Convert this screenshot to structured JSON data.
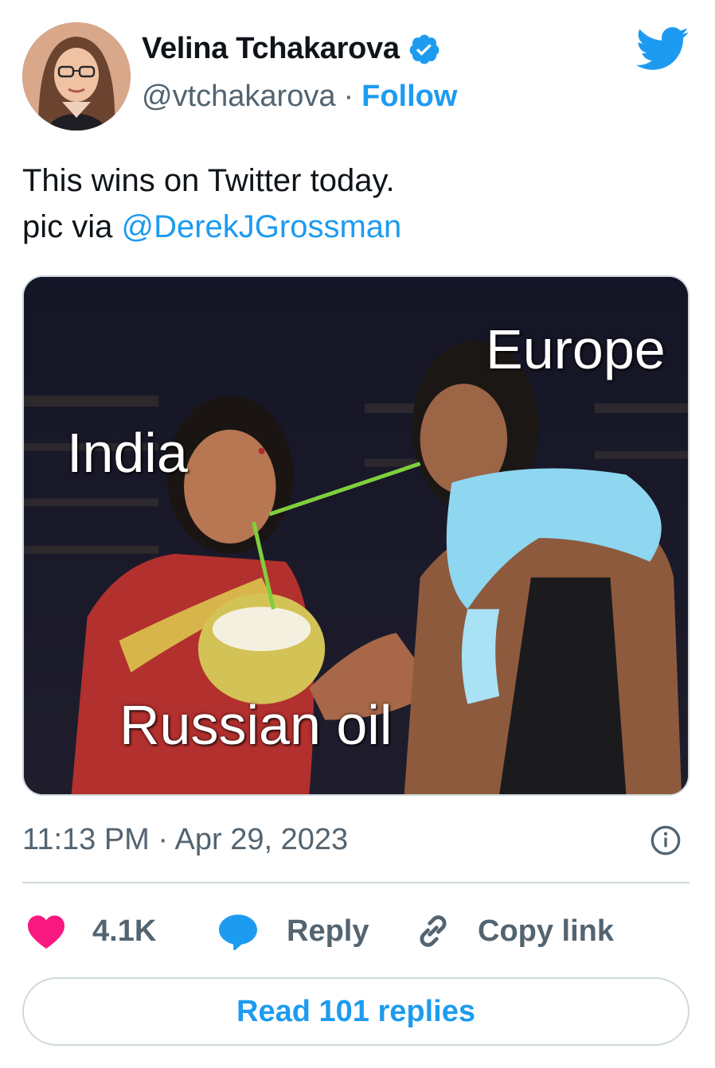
{
  "author": {
    "name": "Velina Tchakarova",
    "handle": "@vtchakarova",
    "separator": "·",
    "follow_label": "Follow",
    "verified_icon": "verified-badge-icon",
    "avatar_icon": "profile-photo"
  },
  "brand": {
    "logo_icon": "twitter-bird-icon",
    "accent": "#1d9bf0"
  },
  "tweet": {
    "line1": "This wins on Twitter today.",
    "line2_prefix": "pic via ",
    "mention": "@DerekJGrossman"
  },
  "media": {
    "labels": {
      "europe": "Europe",
      "india": "India",
      "russian_oil": "Russian oil"
    }
  },
  "meta": {
    "timestamp": "11:13 PM · Apr 29, 2023",
    "info_icon": "info-icon"
  },
  "actions": {
    "like_count": "4.1K",
    "reply_label": "Reply",
    "copy_label": "Copy link"
  },
  "footer": {
    "read_replies_label": "Read 101 replies"
  },
  "colors": {
    "like": "#f91880",
    "reply": "#1d9bf0",
    "muted": "#536471",
    "border": "#cfd9de"
  }
}
